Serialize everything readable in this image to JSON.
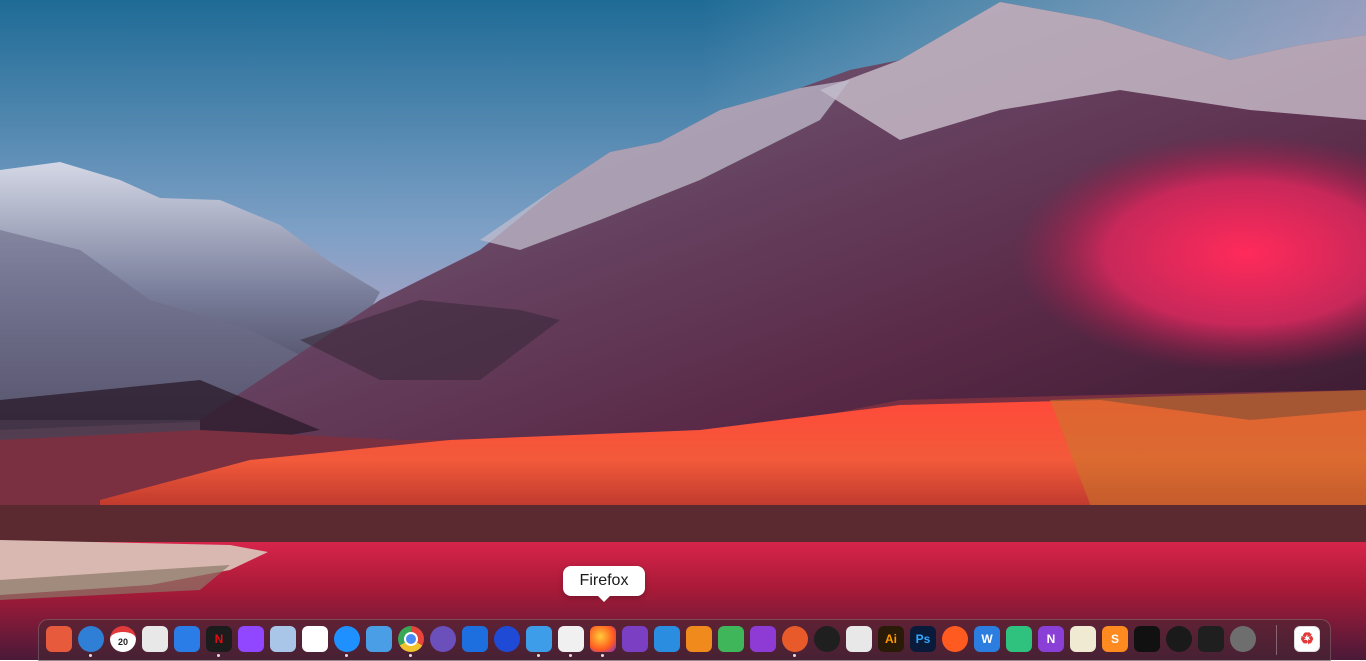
{
  "tooltip": {
    "label": "Firefox"
  },
  "calendar": {
    "day": "20"
  },
  "dock": {
    "apps": [
      {
        "name": "books",
        "glyph": "",
        "color": "#e85a3c",
        "running": false
      },
      {
        "name": "mail",
        "glyph": "",
        "color": "#2f7fd6",
        "running": true
      },
      {
        "name": "calendar",
        "glyph": "20",
        "color": "#ffffff",
        "running": false
      },
      {
        "name": "transmission",
        "glyph": "",
        "color": "#e8e8e8",
        "running": false
      },
      {
        "name": "dropbox",
        "glyph": "",
        "color": "#2a7ce6",
        "running": false
      },
      {
        "name": "netflix",
        "glyph": "N",
        "color": "#1c1c1c",
        "running": true
      },
      {
        "name": "twitch",
        "glyph": "",
        "color": "#9146ff",
        "running": false
      },
      {
        "name": "virtualbox",
        "glyph": "",
        "color": "#a9c6e8",
        "running": false
      },
      {
        "name": "telegram",
        "glyph": "",
        "color": "#ffffff",
        "running": false
      },
      {
        "name": "shazam",
        "glyph": "",
        "color": "#1e90ff",
        "running": true
      },
      {
        "name": "printer",
        "glyph": "",
        "color": "#4a9ee6",
        "running": false
      },
      {
        "name": "chrome",
        "glyph": "",
        "color": "#f2c12e",
        "running": true
      },
      {
        "name": "atom",
        "glyph": "",
        "color": "#6b4fbb",
        "running": false
      },
      {
        "name": "teamviewer",
        "glyph": "",
        "color": "#1d6fe0",
        "running": false
      },
      {
        "name": "brave",
        "glyph": "",
        "color": "#1f4ad6",
        "running": false
      },
      {
        "name": "files",
        "glyph": "",
        "color": "#3e9de8",
        "running": true
      },
      {
        "name": "microsoft-store",
        "glyph": "",
        "color": "#f0f0f0",
        "running": true
      },
      {
        "name": "firefox",
        "glyph": "",
        "color": "#ff7a1f",
        "running": true
      },
      {
        "name": "visual-studio",
        "glyph": "",
        "color": "#7b3fc4",
        "running": false
      },
      {
        "name": "vscode",
        "glyph": "",
        "color": "#2a8de0",
        "running": false
      },
      {
        "name": "fl-studio",
        "glyph": "",
        "color": "#f08a1c",
        "running": false
      },
      {
        "name": "layers",
        "glyph": "",
        "color": "#3fb65a",
        "running": false
      },
      {
        "name": "prism",
        "glyph": "",
        "color": "#8e3bd6",
        "running": false
      },
      {
        "name": "davinci",
        "glyph": "",
        "color": "#e85a2a",
        "running": true
      },
      {
        "name": "figma",
        "glyph": "",
        "color": "#1f1f1f",
        "running": false
      },
      {
        "name": "acrobat",
        "glyph": "",
        "color": "#e8e8e8",
        "running": false
      },
      {
        "name": "illustrator",
        "glyph": "Ai",
        "color": "#2a1a08",
        "running": false
      },
      {
        "name": "photoshop",
        "glyph": "Ps",
        "color": "#0a1a3a",
        "running": false
      },
      {
        "name": "soundcloud",
        "glyph": "",
        "color": "#ff5a1f",
        "running": false
      },
      {
        "name": "word",
        "glyph": "W",
        "color": "#2b7de0",
        "running": false
      },
      {
        "name": "xmind",
        "glyph": "",
        "color": "#2ec27e",
        "running": false
      },
      {
        "name": "onenote",
        "glyph": "N",
        "color": "#8a3fd6",
        "running": false
      },
      {
        "name": "notes",
        "glyph": "",
        "color": "#f0ead2",
        "running": false
      },
      {
        "name": "sublime",
        "glyph": "S",
        "color": "#ff8a1f",
        "running": false
      },
      {
        "name": "tidal",
        "glyph": "",
        "color": "#111111",
        "running": false
      },
      {
        "name": "xbox",
        "glyph": "",
        "color": "#1a1a1a",
        "running": false
      },
      {
        "name": "terminal",
        "glyph": "",
        "color": "#1f1f1f",
        "running": false
      },
      {
        "name": "system-preferences",
        "glyph": "",
        "color": "#6e6e6e",
        "running": false
      },
      {
        "name": "trash",
        "glyph": "",
        "color": "#ffffff",
        "running": false
      }
    ]
  }
}
